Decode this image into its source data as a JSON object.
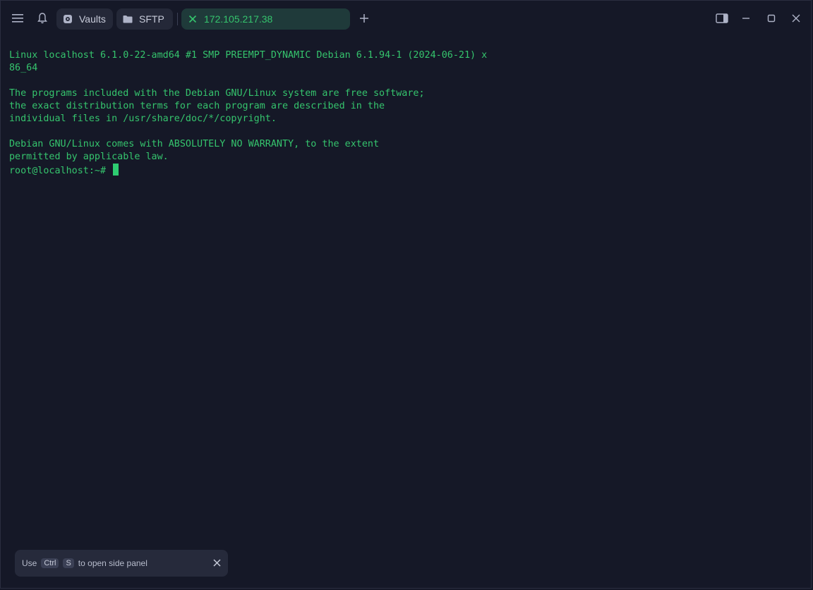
{
  "titlebar": {
    "tabs": [
      {
        "label": "Vaults",
        "icon": "vault-icon"
      },
      {
        "label": "SFTP",
        "icon": "folder-icon"
      },
      {
        "label": "172.105.217.38",
        "icon": "close-icon",
        "active": true
      }
    ],
    "icons": [
      "menu-icon",
      "bell-icon",
      "add-tab-icon",
      "side-panel-icon",
      "minimize-icon",
      "maximize-icon",
      "close-window-icon"
    ]
  },
  "terminal": {
    "lines": [
      "Linux localhost 6.1.0-22-amd64 #1 SMP PREEMPT_DYNAMIC Debian 6.1.94-1 (2024-06-21) x",
      "86_64",
      "",
      "The programs included with the Debian GNU/Linux system are free software;",
      "the exact distribution terms for each program are described in the",
      "individual files in /usr/share/doc/*/copyright.",
      "",
      "Debian GNU/Linux comes with ABSOLUTELY NO WARRANTY, to the extent",
      "permitted by applicable law."
    ],
    "prompt": "root@localhost:~#"
  },
  "hint": {
    "prefix": "Use",
    "key1": "Ctrl",
    "key2": "S",
    "suffix": "to open side panel"
  },
  "colors": {
    "background": "#151827",
    "terminal_text": "#35c46d",
    "tab_bg": "#242838",
    "active_tab_bg": "#1f3a3a"
  }
}
